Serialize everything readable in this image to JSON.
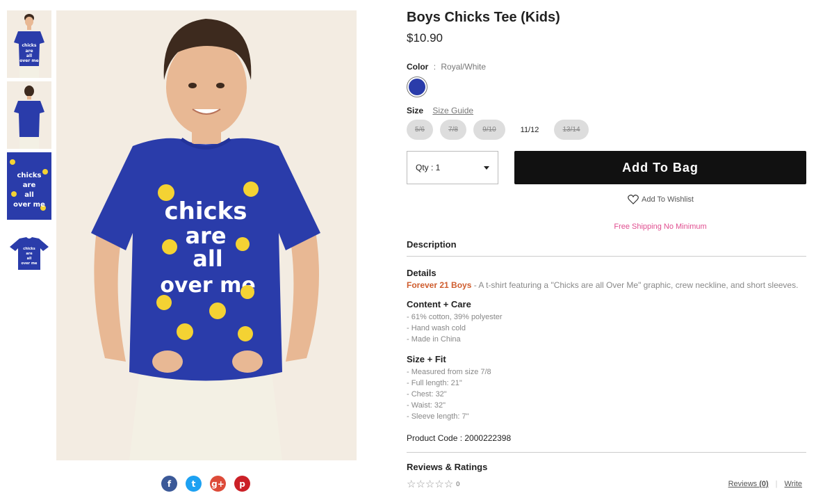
{
  "product": {
    "title": "Boys Chicks Tee (Kids)",
    "price": "$10.90"
  },
  "color": {
    "label": "Color",
    "separator": ":",
    "value": "Royal/White",
    "swatch_hex": "#2a3caa"
  },
  "size": {
    "label": "Size",
    "guide_label": "Size Guide",
    "options": [
      {
        "label": "5/6",
        "available": false
      },
      {
        "label": "7/8",
        "available": false
      },
      {
        "label": "9/10",
        "available": false
      },
      {
        "label": "11/12",
        "available": true
      },
      {
        "label": "13/14",
        "available": false
      }
    ]
  },
  "purchase": {
    "qty_label": "Qty : 1",
    "add_to_bag": "Add To Bag",
    "wishlist": "Add To Wishlist",
    "shipping": "Free Shipping No Minimum"
  },
  "description": {
    "heading": "Description",
    "details_title": "Details",
    "brand": "Forever 21 Boys",
    "details_text": " - A t-shirt featuring a \"Chicks are all Over Me\" graphic, crew neckline, and short sleeves.",
    "content_title": "Content + Care",
    "content_items": [
      "- 61% cotton, 39% polyester",
      "- Hand wash cold",
      "- Made in China"
    ],
    "fit_title": "Size + Fit",
    "fit_items": [
      "- Measured from size 7/8",
      "- Full length: 21\"",
      "- Chest: 32\"",
      "- Waist: 32\"",
      "- Sleeve length: 7\""
    ],
    "product_code": "Product Code : 2000222398"
  },
  "reviews": {
    "heading": "Reviews & Ratings",
    "rating_count": "0",
    "reviews_link_prefix": "Reviews ",
    "reviews_count": "(0)",
    "write_link": "Write"
  },
  "graphic": {
    "lines": [
      "chicks",
      "are",
      "all",
      "over me"
    ]
  },
  "social": [
    {
      "icon": "facebook-icon",
      "glyph": "f",
      "color": "#3b5998"
    },
    {
      "icon": "twitter-icon",
      "glyph": "t",
      "color": "#1da1f2"
    },
    {
      "icon": "google-plus-icon",
      "glyph": "g+",
      "color": "#dd4b39"
    },
    {
      "icon": "pinterest-icon",
      "glyph": "p",
      "color": "#cb2027"
    }
  ],
  "colors": {
    "shirt": "#2a3caa",
    "skin": "#e8b894",
    "hair": "#3d2a1e",
    "shorts": "#f3f0e4",
    "chick": "#f4d233",
    "backdrop": "#f3ece2"
  }
}
